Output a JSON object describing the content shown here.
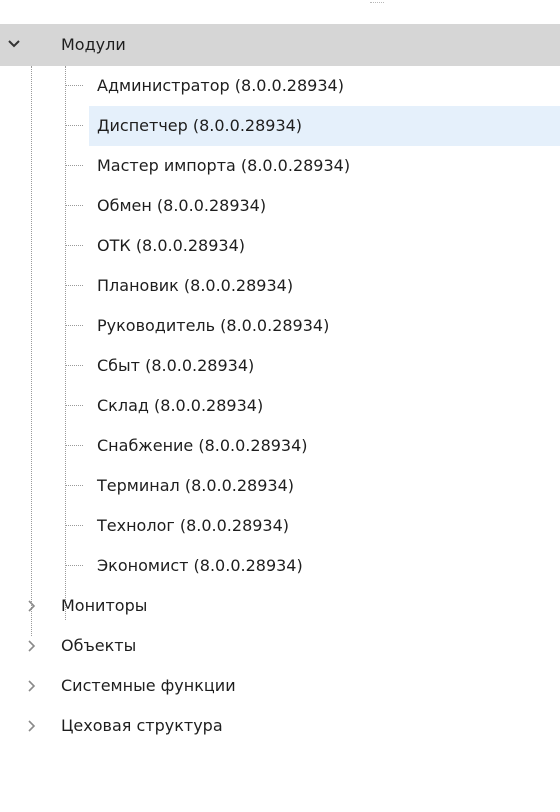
{
  "tree": {
    "expanded_group": {
      "label": "Модули",
      "icon": "chevron-down-icon",
      "children": [
        {
          "label": "Администратор (8.0.0.28934)",
          "selected": false
        },
        {
          "label": "Диспетчер (8.0.0.28934)",
          "selected": true
        },
        {
          "label": "Мастер импорта (8.0.0.28934)",
          "selected": false
        },
        {
          "label": "Обмен (8.0.0.28934)",
          "selected": false
        },
        {
          "label": "ОТК (8.0.0.28934)",
          "selected": false
        },
        {
          "label": "Плановик (8.0.0.28934)",
          "selected": false
        },
        {
          "label": "Руководитель (8.0.0.28934)",
          "selected": false
        },
        {
          "label": "Сбыт (8.0.0.28934)",
          "selected": false
        },
        {
          "label": "Склад (8.0.0.28934)",
          "selected": false
        },
        {
          "label": "Снабжение (8.0.0.28934)",
          "selected": false
        },
        {
          "label": "Терминал (8.0.0.28934)",
          "selected": false
        },
        {
          "label": "Технолог (8.0.0.28934)",
          "selected": false
        },
        {
          "label": "Экономист (8.0.0.28934)",
          "selected": false
        }
      ]
    },
    "collapsed_groups": [
      {
        "label": "Мониторы",
        "icon": "chevron-right-icon"
      },
      {
        "label": "Объекты",
        "icon": "chevron-right-icon"
      },
      {
        "label": "Системные функции",
        "icon": "chevron-right-icon"
      },
      {
        "label": "Цеховая структура",
        "icon": "chevron-right-icon"
      }
    ]
  },
  "colors": {
    "group_header_bg": "#d6d6d6",
    "selection_bg": "#e5f0fb",
    "text": "#1e1e1e",
    "tree_lines": "#9a9a9a",
    "chevron_collapsed": "#8a8a8a",
    "chevron_expanded": "#333333"
  }
}
